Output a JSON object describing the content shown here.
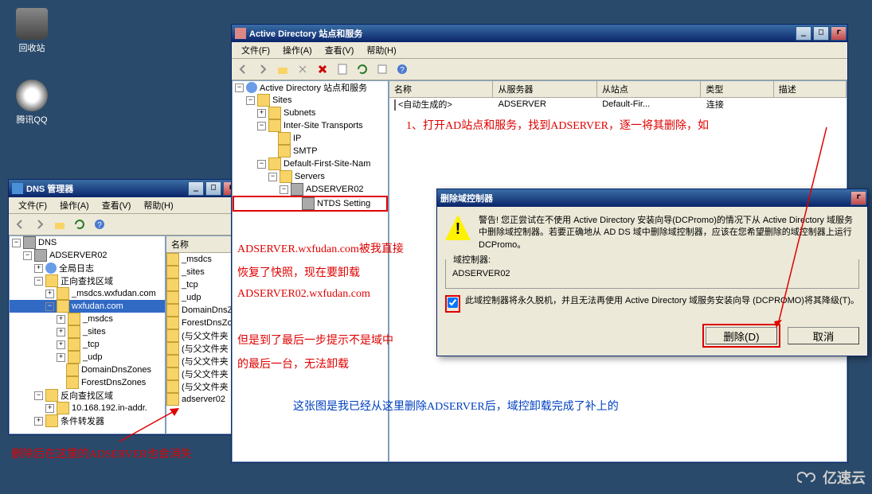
{
  "desktop": {
    "icons": [
      {
        "label": "回收站",
        "name": "recycle-bin"
      },
      {
        "label": "腾讯QQ",
        "name": "tencent-qq"
      }
    ]
  },
  "dns": {
    "title": "DNS 管理器",
    "menu": {
      "file": "文件(F)",
      "action": "操作(A)",
      "view": "查看(V)",
      "help": "帮助(H)"
    },
    "tree": [
      {
        "t": "DNS",
        "d": 0,
        "o": true,
        "i": "server"
      },
      {
        "t": "ADSERVER02",
        "d": 1,
        "o": true,
        "i": "server"
      },
      {
        "t": "全局日志",
        "d": 2,
        "o": false,
        "i": "globe"
      },
      {
        "t": "正向查找区域",
        "d": 2,
        "o": true,
        "i": "folder"
      },
      {
        "t": "_msdcs.wxfudan.com",
        "d": 3,
        "o": false,
        "i": "folder"
      },
      {
        "t": "wxfudan.com",
        "d": 3,
        "o": true,
        "i": "folder",
        "sel": true
      },
      {
        "t": "_msdcs",
        "d": 4,
        "o": false,
        "i": "folder"
      },
      {
        "t": "_sites",
        "d": 4,
        "o": false,
        "i": "folder"
      },
      {
        "t": "_tcp",
        "d": 4,
        "o": false,
        "i": "folder"
      },
      {
        "t": "_udp",
        "d": 4,
        "o": false,
        "i": "folder"
      },
      {
        "t": "DomainDnsZones",
        "d": 4,
        "i": "folder"
      },
      {
        "t": "ForestDnsZones",
        "d": 4,
        "i": "folder"
      },
      {
        "t": "反向查找区域",
        "d": 2,
        "o": true,
        "i": "folder"
      },
      {
        "t": "10.168.192.in-addr.",
        "d": 3,
        "o": false,
        "i": "folder"
      },
      {
        "t": "条件转发器",
        "d": 2,
        "o": false,
        "i": "folder"
      }
    ],
    "list_hdr": "名称",
    "list": [
      "_msdcs",
      "_sites",
      "_tcp",
      "_udp",
      "DomainDnsZones",
      "ForestDnsZones",
      "(与父文件夹",
      "(与父文件夹",
      "(与父文件夹",
      "(与父文件夹",
      "(与父文件夹",
      "adserver02"
    ]
  },
  "adss": {
    "title": "Active Directory 站点和服务",
    "menu": {
      "file": "文件(F)",
      "action": "操作(A)",
      "view": "查看(V)",
      "help": "帮助(H)"
    },
    "tree": [
      {
        "t": "Active Directory 站点和服务",
        "d": 0,
        "o": true,
        "i": "globe"
      },
      {
        "t": "Sites",
        "d": 1,
        "o": true,
        "i": "folder"
      },
      {
        "t": "Subnets",
        "d": 2,
        "o": false,
        "i": "folder"
      },
      {
        "t": "Inter-Site Transports",
        "d": 2,
        "o": true,
        "i": "folder"
      },
      {
        "t": "IP",
        "d": 3,
        "i": "folder"
      },
      {
        "t": "SMTP",
        "d": 3,
        "i": "folder"
      },
      {
        "t": "Default-First-Site-Nam",
        "d": 2,
        "o": true,
        "i": "folder"
      },
      {
        "t": "Servers",
        "d": 3,
        "o": true,
        "i": "folder"
      },
      {
        "t": "ADSERVER02",
        "d": 4,
        "o": true,
        "i": "server"
      },
      {
        "t": "NTDS Setting",
        "d": 5,
        "i": "server",
        "box": true
      }
    ],
    "list_hdrs": [
      "名称",
      "从服务器",
      "从站点",
      "类型",
      "描述"
    ],
    "list_row": [
      "<自动生成的>",
      "ADSERVER",
      "Default-Fir...",
      "连接",
      ""
    ]
  },
  "dialog": {
    "title": "删除域控制器",
    "warn": "警告! 您正尝试在不使用 Active Directory 安装向导(DCPromo)的情况下从 Active Directory 域服务中删除域控制器。若要正确地从 AD DS 域中删除域控制器，应该在您希望删除的域控制器上运行 DCPromo。",
    "dc_label": "域控制器:",
    "dc_value": "ADSERVER02",
    "checkbox_label": "此域控制器将永久脱机，并且无法再使用 Active Directory 域服务安装向导 (DCPROMO)将其降级(T)。",
    "checked": true,
    "btn_delete": "删除(D)",
    "btn_cancel": "取消"
  },
  "ann": {
    "a1": "1、打开AD站点和服务，找到ADSERVER，逐一将其删除，如",
    "a2": "ADSERVER.wxfudan.com被我直接",
    "a3": "恢复了快照，现在要卸载",
    "a4": "ADSERVER02.wxfudan.com",
    "a5": "但是到了最后一步提示不是域中",
    "a6": "的最后一台，无法卸载",
    "a7": "这张图是我已经从这里删除ADSERVER后，域控卸载完成了补上的",
    "a8": "删除后在这里的ADSERVER也会消失"
  },
  "yisu": "亿速云"
}
